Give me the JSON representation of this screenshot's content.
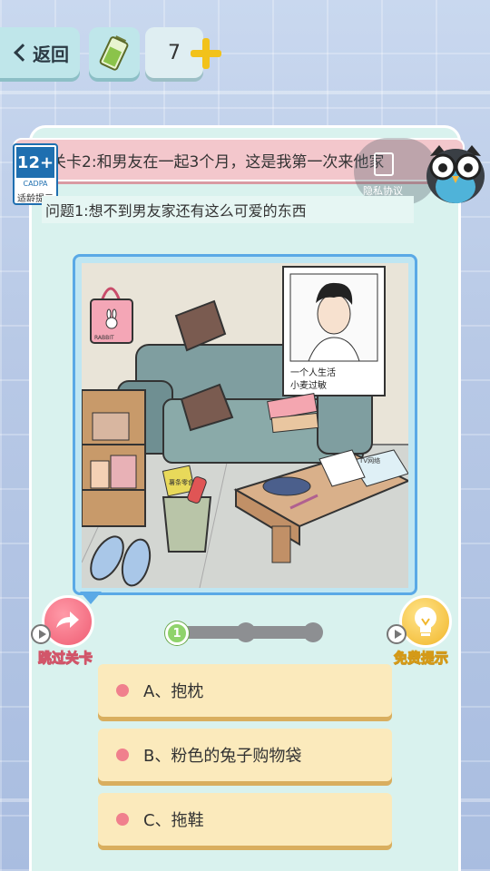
{
  "top_bar": {
    "back_label": "返回",
    "hint_count": "7"
  },
  "age_rating": {
    "rating": "12+",
    "org": "CADPA",
    "tip": "适龄提示"
  },
  "level": {
    "title": "关卡2:和男友在一起3个月，这是我第一次来他家"
  },
  "privacy": {
    "label": "隐私协议"
  },
  "question": {
    "text": "问题1:想不到男友家还有这么可爱的东西"
  },
  "scene": {
    "photo_caption_line1": "一个人生活",
    "photo_caption_line2": "小麦过敏",
    "bag_text": "RABBIT",
    "snack_text": "薯条零食",
    "book_text": "TV网络"
  },
  "actions": {
    "skip_label": "跳过关卡",
    "hint_label": "免费提示"
  },
  "progress": {
    "current": "1",
    "total_steps": 3
  },
  "options": [
    {
      "label": "A、抱枕"
    },
    {
      "label": "B、粉色的兔子购物袋"
    },
    {
      "label": "C、拖鞋"
    }
  ],
  "colors": {
    "panel": "#d9f2ee",
    "banner": "#f3c7cc",
    "option": "#fbeabc",
    "frame_border": "#5aa9e6"
  }
}
